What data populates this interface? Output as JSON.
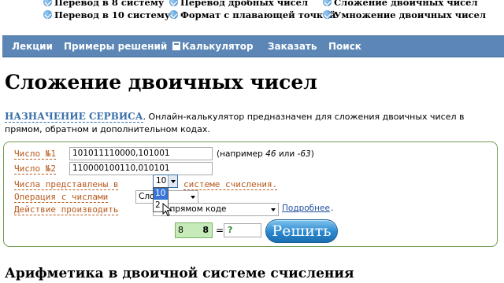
{
  "top_links": [
    {
      "label": "Перевод в 8 систему"
    },
    {
      "label": "Перевод дробных чисел"
    },
    {
      "label": "Сложение двоичных чисел"
    },
    {
      "label": "Перевод в 10 систему"
    },
    {
      "label": "Формат с плавающей точкой"
    },
    {
      "label": "Умножение двоичных чисел"
    }
  ],
  "nav": {
    "items": [
      "Лекции",
      "Примеры решений",
      "Калькулятор",
      "Заказать",
      "Поиск"
    ]
  },
  "page_title": "Сложение двоичных чисел",
  "intro": {
    "tag": "НАЗНАЧЕНИЕ СЕРВИСА",
    "text": ". Онлайн-калькулятор предназначен для сложения двоичных чисел в прямом, обратном и дополнительном кодах."
  },
  "form": {
    "number1_label": "Число №1",
    "number1_value": "101011110000,101001",
    "number2_label": "Число №2",
    "number2_value": "110000100110,010101",
    "example_prefix": "(например ",
    "example_a": "46",
    "example_mid": " или ",
    "example_b": "-63",
    "example_suffix": ")",
    "base_label_pre": "Числа представлены в",
    "base_value": "10",
    "base_label_post": "системе счисления.",
    "base_options": [
      "10",
      "2"
    ],
    "operation_label": "Операция с числами",
    "operation_value": "Сложе",
    "action_label": "Действие производить",
    "action_value": "в прямом коде",
    "more_link": "Подробнее",
    "result_left_a": "8",
    "result_left_b": "8",
    "equals": "=",
    "result_value": "?",
    "solve_button": "Решить"
  },
  "section_title": "Арифметика в двоичной системе счисления",
  "colors": {
    "nav_bg": "#5b86b5",
    "label_orange": "#b85a1e",
    "intro_blue": "#3a6fa8",
    "button_blue": "#2b88cf",
    "result_green": "#c7eab9"
  }
}
